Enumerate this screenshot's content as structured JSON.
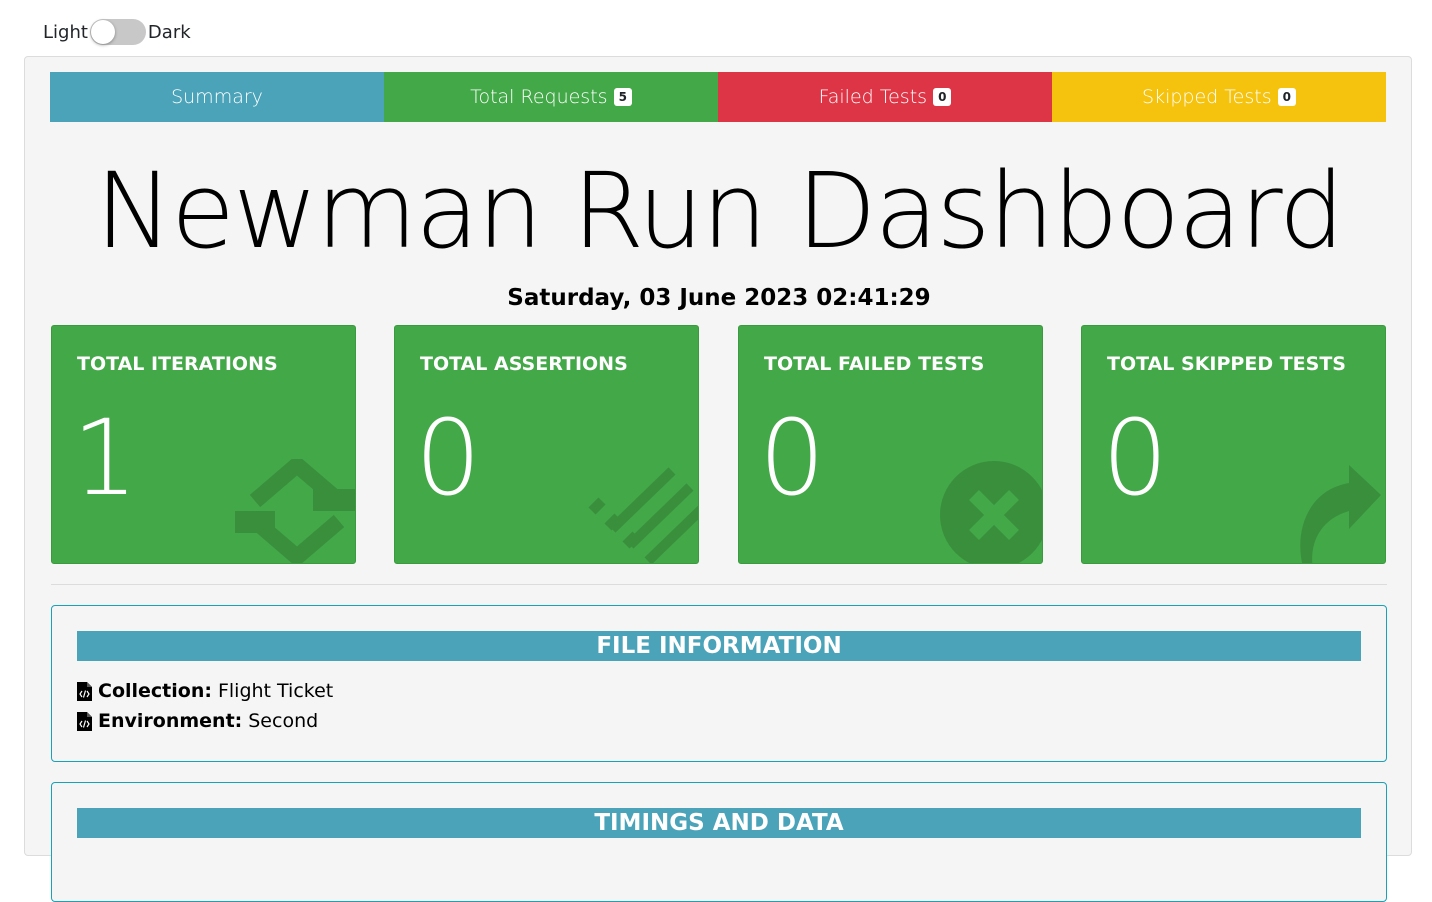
{
  "theme": {
    "light_label": "Light",
    "dark_label": "Dark"
  },
  "tabs": [
    {
      "label": "Summary",
      "badge": "",
      "color": "#4aa3b8"
    },
    {
      "label": "Total Requests",
      "badge": "5",
      "color": "#43a847"
    },
    {
      "label": "Failed Tests",
      "badge": "0",
      "color": "#dd3545"
    },
    {
      "label": "Skipped Tests",
      "badge": "0",
      "color": "#f5c20e"
    }
  ],
  "title": "Newman Run Dashboard",
  "datetime": "Saturday, 03 June 2023 02:41:29",
  "cards": [
    {
      "title": "TOTAL ITERATIONS",
      "value": "1",
      "icon": "sync-icon"
    },
    {
      "title": "TOTAL ASSERTIONS",
      "value": "0",
      "icon": "list-icon"
    },
    {
      "title": "TOTAL FAILED TESTS",
      "value": "0",
      "icon": "times-circle-icon"
    },
    {
      "title": "TOTAL SKIPPED TESTS",
      "value": "0",
      "icon": "share-arrow-icon"
    }
  ],
  "file_info": {
    "heading": "FILE INFORMATION",
    "collection_label": "Collection:",
    "collection_value": "Flight Ticket",
    "environment_label": "Environment:",
    "environment_value": "Second"
  },
  "timings": {
    "heading": "TIMINGS AND DATA"
  },
  "colors": {
    "card_green": "#43a847",
    "panel_border": "#17a2b8",
    "panel_head": "#4aa3b8"
  }
}
